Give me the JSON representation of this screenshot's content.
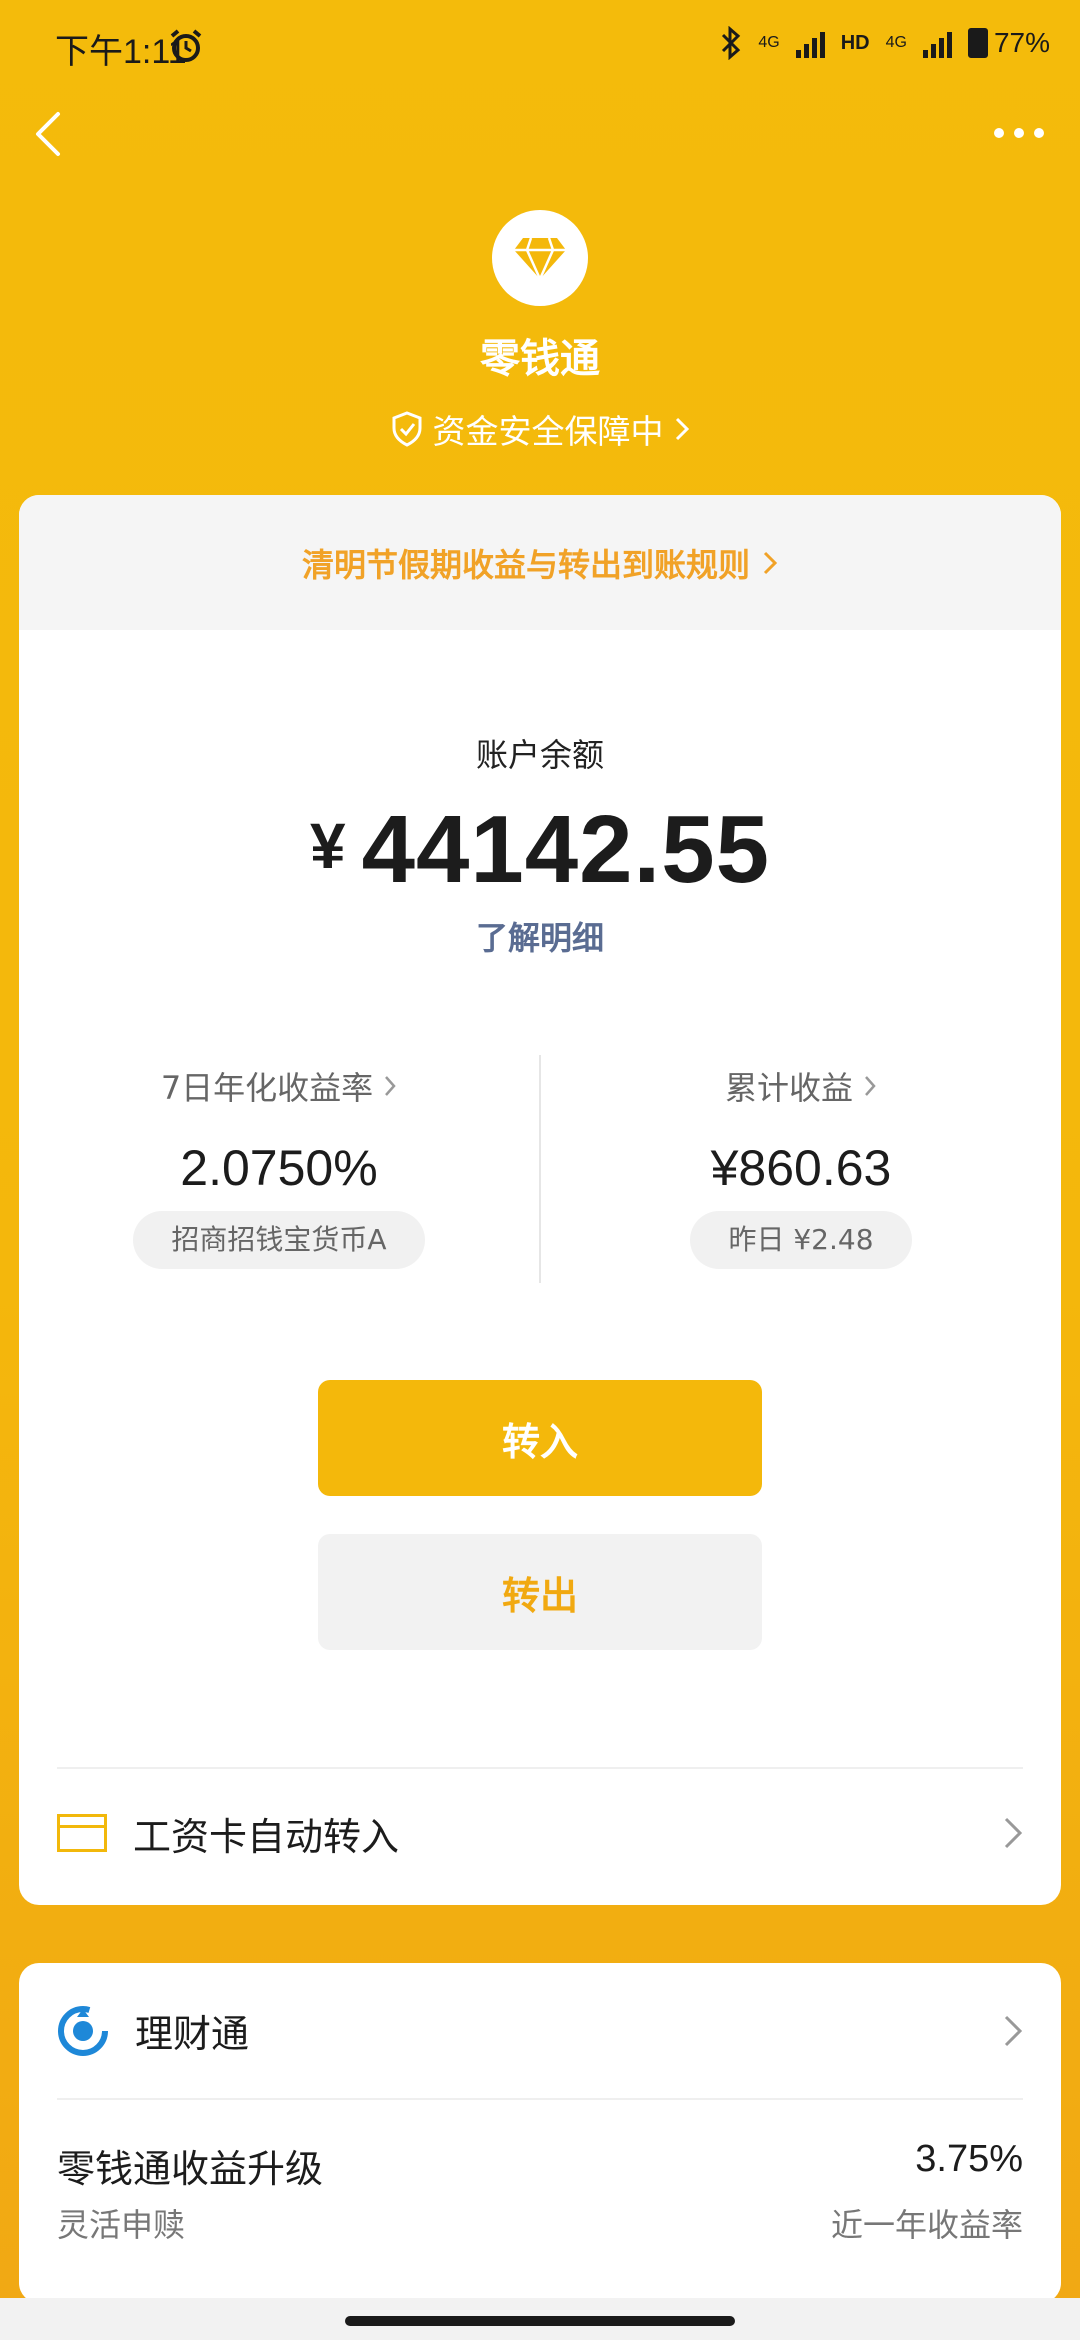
{
  "status_bar": {
    "time": "下午1:11",
    "network_1": "4G",
    "hd": "HD",
    "network_2": "4G",
    "battery": "77%"
  },
  "header": {
    "title": "零钱通",
    "safety_text": "资金安全保障中"
  },
  "notice": {
    "text": "清明节假期收益与转出到账规则"
  },
  "balance": {
    "label": "账户余额",
    "currency": "¥",
    "amount": "44142.55",
    "detail_link": "了解明细"
  },
  "stats": {
    "yield_label": "7日年化收益率",
    "yield_value": "2.0750%",
    "fund_name": "招商招钱宝货币A",
    "income_label": "累计收益",
    "income_value": "¥860.63",
    "yesterday": "昨日 ¥2.48"
  },
  "actions": {
    "transfer_in": "转入",
    "transfer_out": "转出"
  },
  "salary_row": {
    "label": "工资卡自动转入"
  },
  "licaitong": {
    "label": "理财通",
    "upgrade_title": "零钱通收益升级",
    "upgrade_sub": "灵活申赎",
    "rate": "3.75%",
    "rate_label": "近一年收益率"
  },
  "colors": {
    "brand_yellow": "#F4B80B",
    "notice_orange": "#F1A227",
    "link_blue": "#5A6C92"
  }
}
